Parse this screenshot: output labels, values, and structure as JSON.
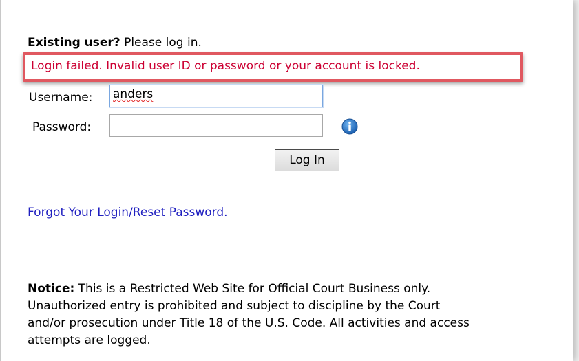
{
  "login": {
    "intro_bold": "Existing user?",
    "intro_rest": " Please log in.",
    "error_message": "Login failed. Invalid user ID or password or your account is locked.",
    "username_label": "Username:",
    "username_value": "anders",
    "password_label": "Password:",
    "password_value": "",
    "info_icon": "info-circle-icon",
    "login_button_label": "Log In",
    "forgot_link": "Forgot Your Login/Reset Password."
  },
  "notice": {
    "title": "Notice:",
    "lines": [
      " This is a Restricted Web Site for Official Court Business only.",
      "Unauthorized entry is prohibited and subject to discipline by the Court",
      "and/or prosecution under Title 18 of the U.S. Code. All activities and access",
      "attempts are logged."
    ]
  },
  "colors": {
    "error_text": "#cc0033",
    "error_border": "#e05860",
    "link": "#2020c0",
    "info_icon": "#1e72c8"
  }
}
